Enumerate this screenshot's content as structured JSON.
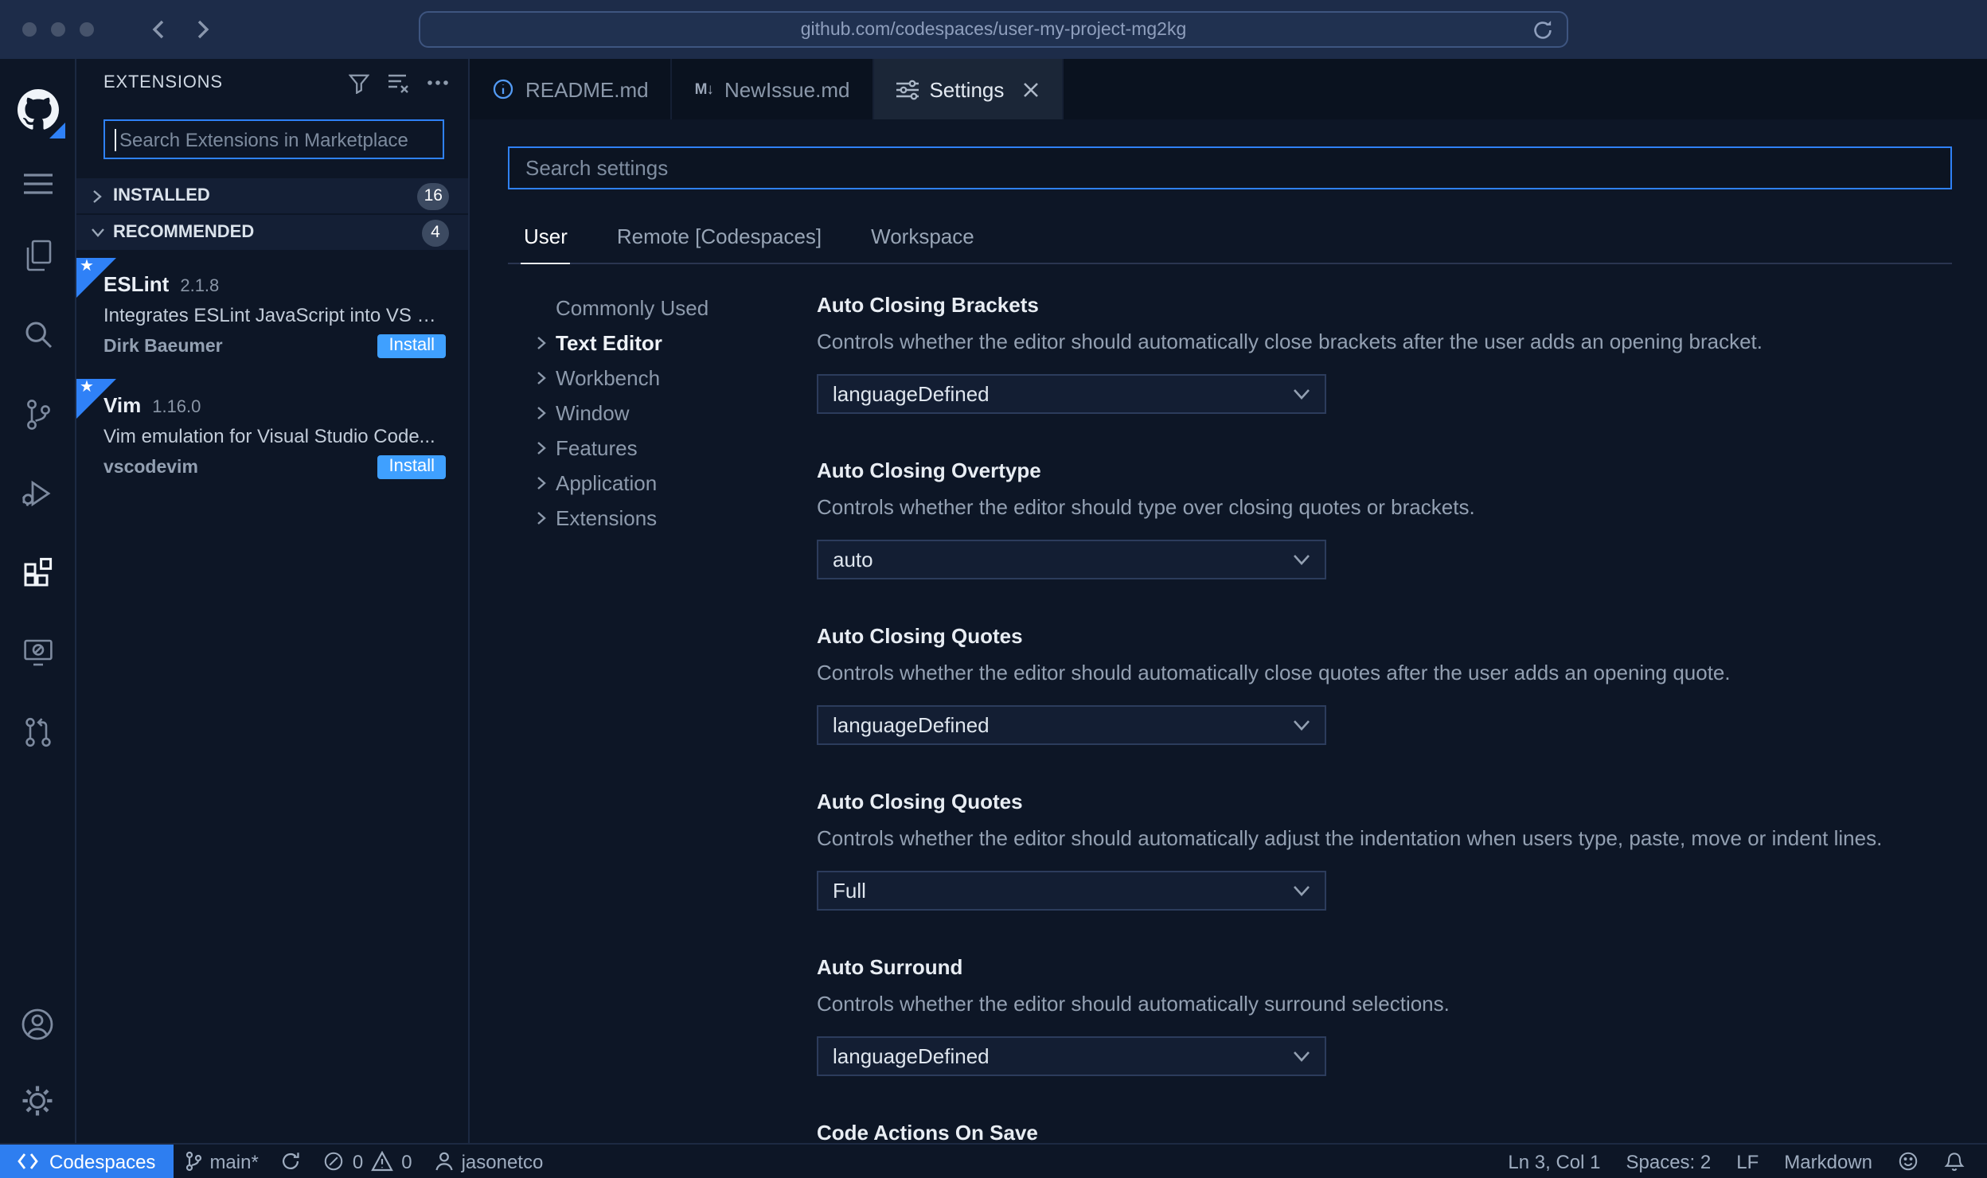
{
  "browser": {
    "url": "github.com/codespaces/user-my-project-mg2kg"
  },
  "colors": {
    "accent_blue": "#2f81f7",
    "install_button_blue": "#3fa0ff",
    "codespaces_chip_blue": "#2e7ef0",
    "background": "#0d1626",
    "chrome": "#1d2c49"
  },
  "activity_bar": {
    "items": [
      "github-logo",
      "menu",
      "explorer",
      "search",
      "source-control",
      "run-debug",
      "extensions",
      "remote-explorer",
      "pull-requests",
      "account",
      "settings-gear"
    ],
    "active": "extensions"
  },
  "sidebar": {
    "title": "EXTENSIONS",
    "search_placeholder": "Search Extensions in Marketplace",
    "sections": [
      {
        "label": "INSTALLED",
        "count": "16"
      },
      {
        "label": "RECOMMENDED",
        "count": "4"
      }
    ],
    "extensions": [
      {
        "name": "ESLint",
        "version": "2.1.8",
        "description": "Integrates ESLint JavaScript into VS C...",
        "author": "Dirk Baeumer",
        "action": "Install"
      },
      {
        "name": "Vim",
        "version": "1.16.0",
        "description": "Vim emulation for Visual Studio Code...",
        "author": "vscodevim",
        "action": "Install"
      }
    ]
  },
  "tabs": [
    {
      "label": "README.md",
      "icon": "info-icon"
    },
    {
      "label": "NewIssue.md",
      "icon": "markdown-icon",
      "icon_text": "M↓"
    },
    {
      "label": "Settings",
      "icon": "settings-sliders-icon"
    }
  ],
  "settings": {
    "search_placeholder": "Search settings",
    "scopes": [
      "User",
      "Remote [Codespaces]",
      "Workspace"
    ],
    "active_scope": "User",
    "toc": [
      "Commonly Used",
      "Text Editor",
      "Workbench",
      "Window",
      "Features",
      "Application",
      "Extensions"
    ],
    "active_toc": "Text Editor",
    "items": [
      {
        "title": "Auto Closing Brackets",
        "description": "Controls whether the editor should automatically close brackets after the user adds an opening bracket.",
        "value": "languageDefined"
      },
      {
        "title": "Auto Closing Overtype",
        "description": "Controls whether the editor should type over closing quotes or brackets.",
        "value": "auto"
      },
      {
        "title": "Auto Closing Quotes",
        "description": "Controls whether the editor should automatically close quotes after the user adds an opening quote.",
        "value": "languageDefined"
      },
      {
        "title": "Auto Closing Quotes",
        "description": "Controls whether the editor should automatically adjust the indentation when users type, paste, move or indent lines.",
        "value": "Full"
      },
      {
        "title": "Auto Surround",
        "description": "Controls whether the editor should automatically surround selections.",
        "value": "languageDefined"
      },
      {
        "title": "Code Actions On Save"
      }
    ]
  },
  "status_bar": {
    "codespaces": "Codespaces",
    "branch": "main*",
    "errors": "0",
    "warnings": "0",
    "user": "jasonetco",
    "cursor": "Ln 3, Col 1",
    "indentation": "Spaces: 2",
    "eol": "LF",
    "language": "Markdown"
  }
}
